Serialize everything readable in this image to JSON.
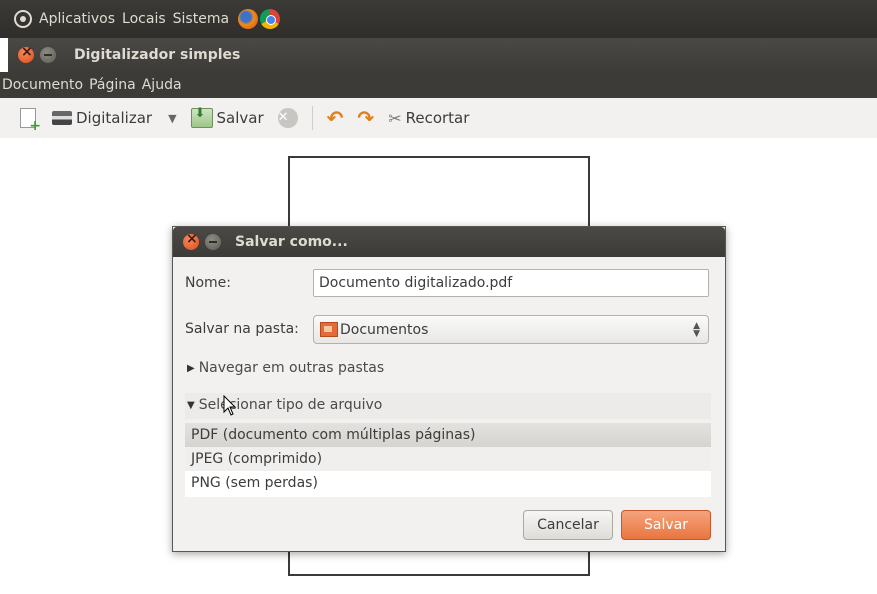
{
  "top_panel": {
    "menus": [
      "Aplicativos",
      "Locais",
      "Sistema"
    ],
    "launchers": [
      "firefox-icon",
      "chrome-icon"
    ]
  },
  "app": {
    "title": "Digitalizador simples",
    "menubar": [
      "Documento",
      "Página",
      "Ajuda"
    ],
    "toolbar": {
      "scan_label": "Digitalizar",
      "save_label": "Salvar",
      "crop_label": "Recortar"
    }
  },
  "dialog": {
    "title": "Salvar como...",
    "name_label": "Nome:",
    "name_value": "Documento digitalizado.pdf",
    "folder_label": "Salvar na pasta:",
    "folder_value": "Documentos",
    "browse_label": "Navegar em outras pastas",
    "filetype_label": "Selecionar tipo de arquivo",
    "file_types": [
      "PDF (documento com múltiplas páginas)",
      "JPEG (comprimido)",
      "PNG (sem perdas)"
    ],
    "selected_file_type": "PDF (documento com múltiplas páginas)",
    "cancel_label": "Cancelar",
    "save_label": "Salvar"
  },
  "colors": {
    "panel": "#3c3b37",
    "accent": "#e8763f",
    "window_bg": "#f2f1f0"
  }
}
